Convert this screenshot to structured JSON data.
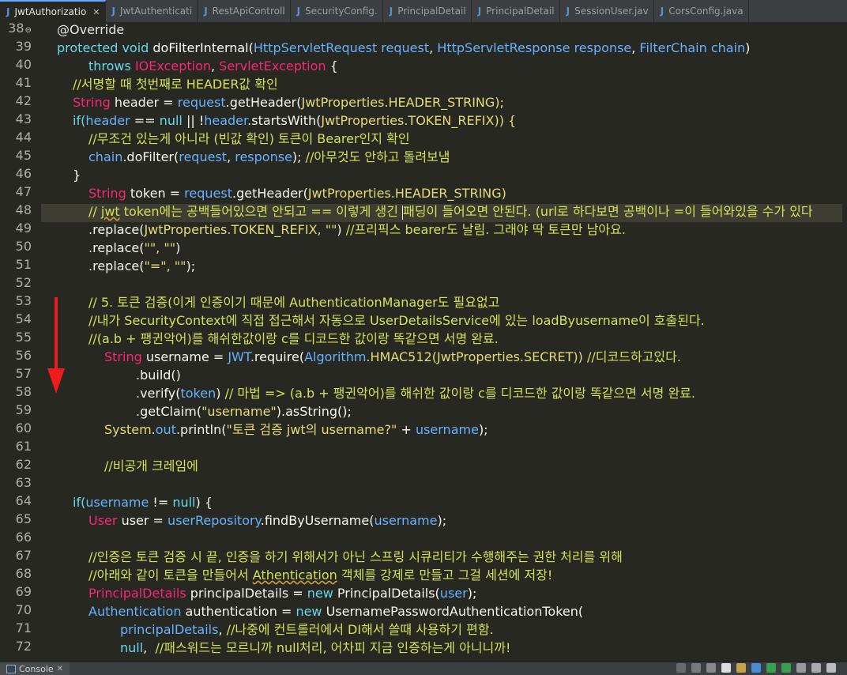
{
  "tabs": [
    {
      "label": "JwtAuthorizatio",
      "active": true,
      "closable": true
    },
    {
      "label": "JwtAuthenticati",
      "active": false
    },
    {
      "label": "RestApiControll",
      "active": false
    },
    {
      "label": "SecurityConfig.",
      "active": false
    },
    {
      "label": "PrincipalDetail",
      "active": false
    },
    {
      "label": "PrincipalDetail",
      "active": false
    },
    {
      "label": "SessionUser.jav",
      "active": false
    },
    {
      "label": "CorsConfig.java",
      "active": false
    }
  ],
  "close_glyph": "✕",
  "line_numbers": [
    "38",
    "39",
    "40",
    "41",
    "42",
    "43",
    "44",
    "45",
    "46",
    "47",
    "48",
    "49",
    "50",
    "51",
    "52",
    "53",
    "54",
    "55",
    "56",
    "57",
    "58",
    "59",
    "60",
    "61",
    "62",
    "63",
    "64",
    "65",
    "66",
    "67",
    "68",
    "69",
    "70",
    "71",
    "72"
  ],
  "fold_marker_line": "38",
  "current_line": "48",
  "annotation": {
    "arrow_color": "#ee1c1c"
  },
  "bottom_panel": {
    "tab_label": "Console"
  },
  "colors": {
    "editor_bg": "#272822",
    "keyword": "#66d9ef",
    "type": "#f92672",
    "comment": "#d4e157",
    "variable": "#66b2ff"
  },
  "code": {
    "l38": "@Override",
    "l39_a": "protected void ",
    "l39_b": "doFilterInternal",
    "l39_c": "(",
    "l39_d": "HttpServletRequest ",
    "l39_e": "request",
    "l39_f": ", ",
    "l39_g": "HttpServletResponse ",
    "l39_h": "response",
    "l39_i": ", ",
    "l39_j": "FilterChain ",
    "l39_k": "chain",
    "l39_l": ")",
    "l40_a": "throws ",
    "l40_b": "IOException",
    "l40_c": ", ",
    "l40_d": "ServletException",
    "l40_e": " {",
    "l41": "//서명할 때 첫번째로 HEADER값 확인",
    "l42_a": "String ",
    "l42_b": "header = ",
    "l42_c": "request",
    "l42_d": ".getHeader(",
    "l42_e": "JwtProperties",
    "l42_f": ".HEADER_STRING);",
    "l43_a": "if(",
    "l43_b": "header",
    "l43_c": " == ",
    "l43_d": "null",
    "l43_e": " || !",
    "l43_f": "header",
    "l43_g": ".startsWith(",
    "l43_h": "JwtProperties",
    "l43_i": ".TOKEN_REFIX)) {",
    "l44": "//무조건 있는게 아니라 (빈값 확인) 토큰이 Bearer인지 확인",
    "l45_a": "chain",
    "l45_b": ".doFilter(",
    "l45_c": "request",
    "l45_d": ", ",
    "l45_e": "response",
    "l45_f": "); ",
    "l45_g": "//아무것도 안하고 돌려보냄",
    "l46": "}",
    "l47_a": "String ",
    "l47_b": "token = ",
    "l47_c": "request",
    "l47_d": ".getHeader(",
    "l47_e": "JwtProperties",
    "l47_f": ".HEADER_STRING)",
    "l48_a": "// ",
    "l48_b": "jwt",
    "l48_c": " token에는 공백들어있으면 안되고 == 이렇게 생긴 ",
    "l48_d": "패딩이 들어오면 안된다. (url로 하다보면 공백이나 =이 들어와있을 수가 있다",
    "l49_a": ".replace(",
    "l49_b": "JwtProperties",
    "l49_c": ".TOKEN_REFIX, ",
    "l49_d": "\"\"",
    "l49_e": ") ",
    "l49_f": "//프리픽스 bearer도 날림. 그래야 딱 토큰만 남아요.",
    "l50_a": ".replace(",
    "l50_b": "\"\", \"\"",
    "l50_c": ")",
    "l51_a": ".replace(",
    "l51_b": "\"=\", \"\"",
    "l51_c": ");",
    "l53": "// 5. 토큰 검증(이게 인증이기 때문에 AuthenticationManager도 필요없고",
    "l54": "//내가 SecurityContext에 직접 접근해서 자동으로 UserDetailsService에 있는 loadByusername이 호출된다.",
    "l55": "//(a.b + 팽귄악어)를 해쉬한값이랑 c를 디코드한 값이랑 똑같으면 서명 완료.",
    "l56_a": "String ",
    "l56_b": "username = ",
    "l56_c": "JWT",
    "l56_d": ".require(",
    "l56_e": "Algorithm",
    "l56_f": ".HMAC512(",
    "l56_g": "JwtProperties",
    "l56_h": ".SECRET)) ",
    "l56_i": "//디코드하고있다.",
    "l57": ".build()",
    "l58_a": ".verify(",
    "l58_b": "token",
    "l58_c": ") ",
    "l58_d": "// 마법 => (a.b + 팽귄악어)를 해쉬한 값이랑 c를 디코드한 값이랑 똑같으면 서명 완료.",
    "l59_a": ".getClaim(",
    "l59_b": "\"username\"",
    "l59_c": ").asString();",
    "l60_a": "System",
    "l60_b": ".",
    "l60_c": "out",
    "l60_d": ".println(",
    "l60_e": "\"토큰 검증 jwt의 username?\"",
    "l60_f": " + ",
    "l60_g": "username",
    "l60_h": ");",
    "l62": "//비공개 크레임에",
    "l64_a": "if(",
    "l64_b": "username",
    "l64_c": " != ",
    "l64_d": "null",
    "l64_e": ") {",
    "l65_a": "User ",
    "l65_b": "user = ",
    "l65_c": "userRepository",
    "l65_d": ".findByUsername(",
    "l65_e": "username",
    "l65_f": ");",
    "l67": "//인증은 토큰 검증 시 끝, 인증을 하기 위해서가 아닌 스프링 시큐리티가 수행해주는 권한 처리를 위해",
    "l68_a": "//아래와 같이 토큰을 만들어서 ",
    "l68_b": "Athentication",
    "l68_c": " 객체를 강제로 만들고 그걸 세션에 저장!",
    "l69_a": "PrincipalDetails ",
    "l69_b": "principalDetails = ",
    "l69_c": "new ",
    "l69_d": "PrincipalDetails(",
    "l69_e": "user",
    "l69_f": ");",
    "l70_a": "Authentication ",
    "l70_b": "authentication = ",
    "l70_c": "new ",
    "l70_d": "UsernamePasswordAuthenticationToken(",
    "l71_a": "principalDetails",
    "l71_b": ", ",
    "l71_c": "//나중에 컨트롤러에서 DI해서 쓸때 사용하기 편함.",
    "l72_a": "null",
    "l72_b": ",  ",
    "l72_c": "//패스워드는 모르니까 null처리, 어차피 지금 인증하는게 아니니까!"
  }
}
